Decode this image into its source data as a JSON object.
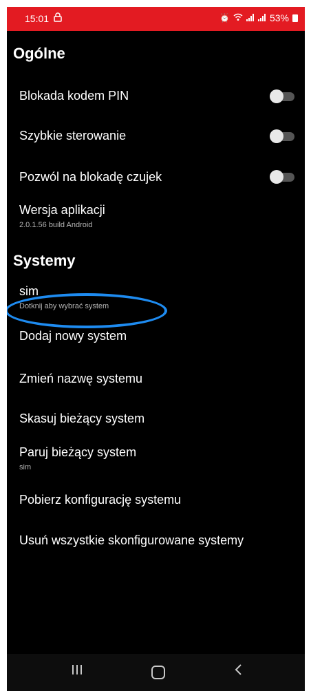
{
  "status_bar": {
    "time": "15:01",
    "battery": "53%",
    "background_color": "#e31b22"
  },
  "general": {
    "title": "Ogólne",
    "pin_lock": {
      "label": "Blokada kodem PIN",
      "enabled": false
    },
    "quick_control": {
      "label": "Szybkie sterowanie",
      "enabled": false
    },
    "sensor_lock": {
      "label": "Pozwól na blokadę czujek",
      "enabled": false
    },
    "app_version": {
      "label": "Wersja aplikacji",
      "value": "2.0.1.56 build Android"
    }
  },
  "systems": {
    "title": "Systemy",
    "current": {
      "label": "sim",
      "hint": "Dotknij aby wybrać system"
    },
    "add_new": "Dodaj nowy system",
    "rename": "Zmień nazwę systemu",
    "delete_current": "Skasuj bieżący system",
    "pair_current": {
      "label": "Paruj bieżący system",
      "value": "sim"
    },
    "download_config": "Pobierz konfigurację systemu",
    "remove_all": "Usuń wszystkie skonfigurowane systemy"
  },
  "annotation": {
    "highlight_color": "#1e8bf0",
    "highlighted_item": "add_new"
  },
  "navigation_bar": {
    "recents_icon": "recents-icon",
    "home_icon": "home-icon",
    "back_icon": "back-icon"
  }
}
